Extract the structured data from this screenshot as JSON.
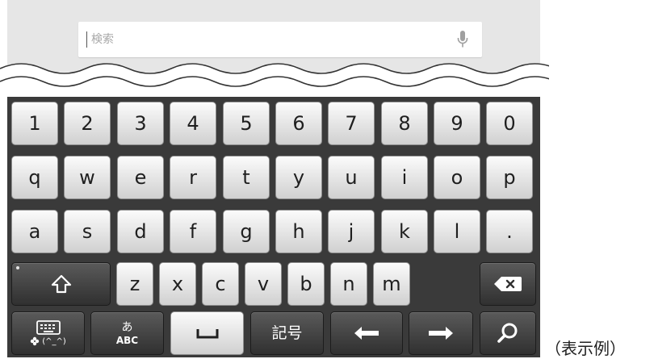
{
  "search": {
    "placeholder": "検索"
  },
  "icons": {
    "mic": "microphone-icon",
    "shift": "shift-arrow-icon",
    "delete": "backspace-icon",
    "keyboard_switch": "keyboard-emoji-switch-icon",
    "input_mode": "hiragana-abc-toggle-icon",
    "space": "space-icon",
    "left": "left-arrow-icon",
    "right": "right-arrow-icon",
    "search": "magnifier-icon"
  },
  "keyboard": {
    "row1": [
      "1",
      "2",
      "3",
      "4",
      "5",
      "6",
      "7",
      "8",
      "9",
      "0"
    ],
    "row2": [
      "q",
      "w",
      "e",
      "r",
      "t",
      "y",
      "u",
      "i",
      "o",
      "p"
    ],
    "row3": [
      "a",
      "s",
      "d",
      "f",
      "g",
      "h",
      "j",
      "k",
      "l",
      "."
    ],
    "row4": [
      "z",
      "x",
      "c",
      "v",
      "b",
      "n",
      "m"
    ],
    "bottom": {
      "emoticon_label": "(^_^)",
      "hiragana_label": "あ",
      "abc_label": "ABC",
      "symbol_label": "記号"
    }
  },
  "caption": "（表示例）",
  "colors": {
    "keyboard_bg": "#3a3a3a",
    "key_light": "#e8e8e8",
    "key_dark": "#404040",
    "top_bg": "#e6e6e6"
  }
}
